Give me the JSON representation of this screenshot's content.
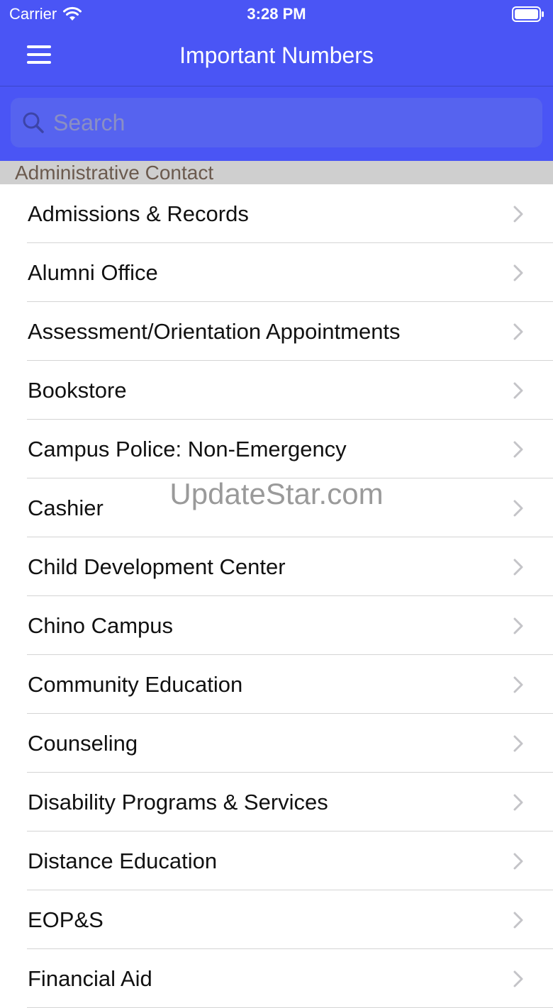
{
  "status_bar": {
    "carrier": "Carrier",
    "time": "3:28 PM"
  },
  "nav": {
    "title": "Important Numbers",
    "menu_icon": "hamburger-menu-icon"
  },
  "search": {
    "placeholder": "Search",
    "value": ""
  },
  "section": {
    "title": "Administrative Contact"
  },
  "items": [
    {
      "label": "Admissions & Records"
    },
    {
      "label": "Alumni Office"
    },
    {
      "label": "Assessment/Orientation Appointments"
    },
    {
      "label": "Bookstore"
    },
    {
      "label": "Campus Police: Non-Emergency"
    },
    {
      "label": "Cashier"
    },
    {
      "label": "Child Development Center"
    },
    {
      "label": "Chino Campus"
    },
    {
      "label": "Community Education"
    },
    {
      "label": "Counseling"
    },
    {
      "label": "Disability Programs & Services"
    },
    {
      "label": "Distance Education"
    },
    {
      "label": "EOP&S"
    },
    {
      "label": "Financial Aid"
    }
  ],
  "watermark": "UpdateStar.com",
  "colors": {
    "header": "#4a55f5",
    "search_field": "#5663ef",
    "section_bg": "#cfcfcf",
    "section_text": "#6b5a4e"
  }
}
